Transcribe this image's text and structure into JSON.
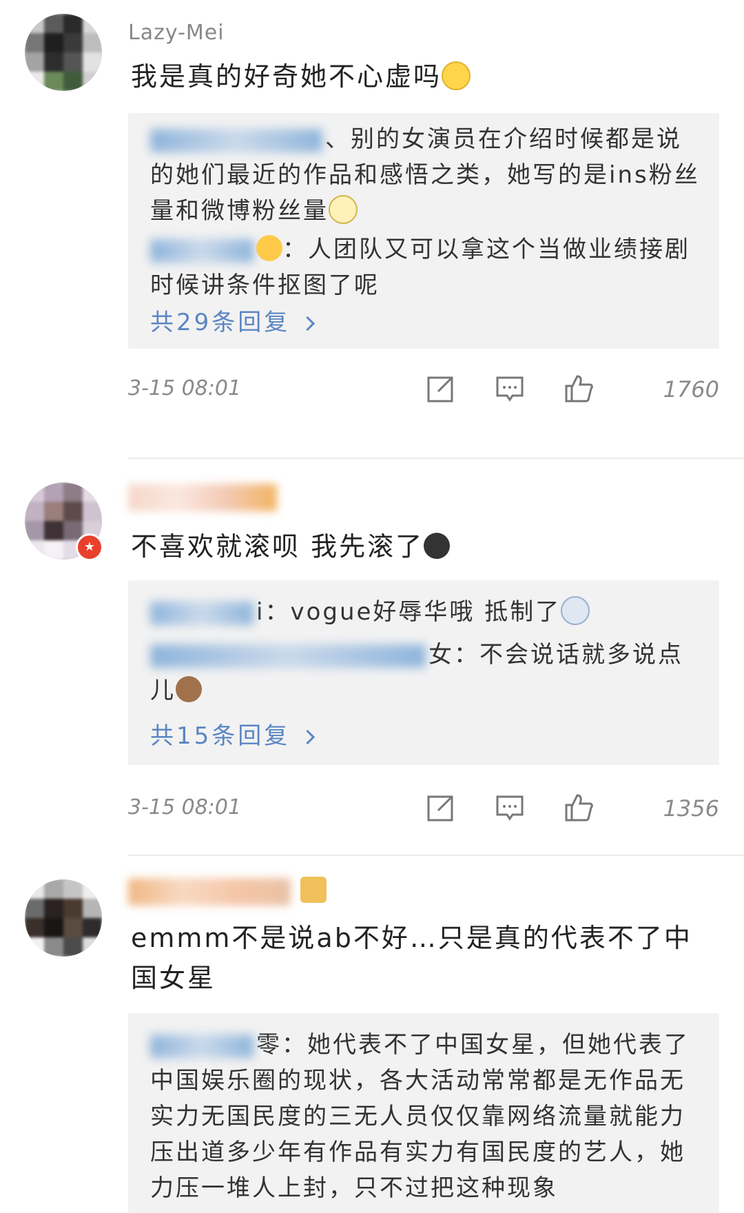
{
  "comments": [
    {
      "username": "Lazy-Mei",
      "text": "我是真的好奇她不心虚吗",
      "replies": [
        {
          "text": "、别的女演员在介绍时候都是说的她们最近的作品和感悟之类，她写的是ins粉丝量和微博粉丝量"
        },
        {
          "text": "：人团队又可以拿这个当做业绩接剧时候讲条件抠图了呢"
        }
      ],
      "more_label": "共29条回复",
      "time": "3-15 08:01",
      "likes": "1760"
    },
    {
      "username": "",
      "text": "不喜欢就滚呗 我先滚了",
      "replies": [
        {
          "text": "i：vogue好辱华哦 抵制了"
        },
        {
          "text": "女：不会说话就多说点儿"
        }
      ],
      "more_label": "共15条回复",
      "time": "3-15 08:01",
      "likes": "1356"
    },
    {
      "username": "",
      "text": "emmm不是说ab不好…只是真的代表不了中国女星",
      "replies": [
        {
          "text": "零：她代表不了中国女星，但她代表了中国娱乐圈的现状，各大活动常常都是无作品无实力无国民度的三无人员仅仅靠网络流量就能力压出道多少年有作品有实力有国民度的艺人，她力压一堆人上封，只不过把这种现象"
        }
      ]
    }
  ],
  "icons": {
    "share": "share-icon",
    "comment": "comment-icon",
    "like": "like-icon",
    "chevron": "chevron-right-icon"
  }
}
